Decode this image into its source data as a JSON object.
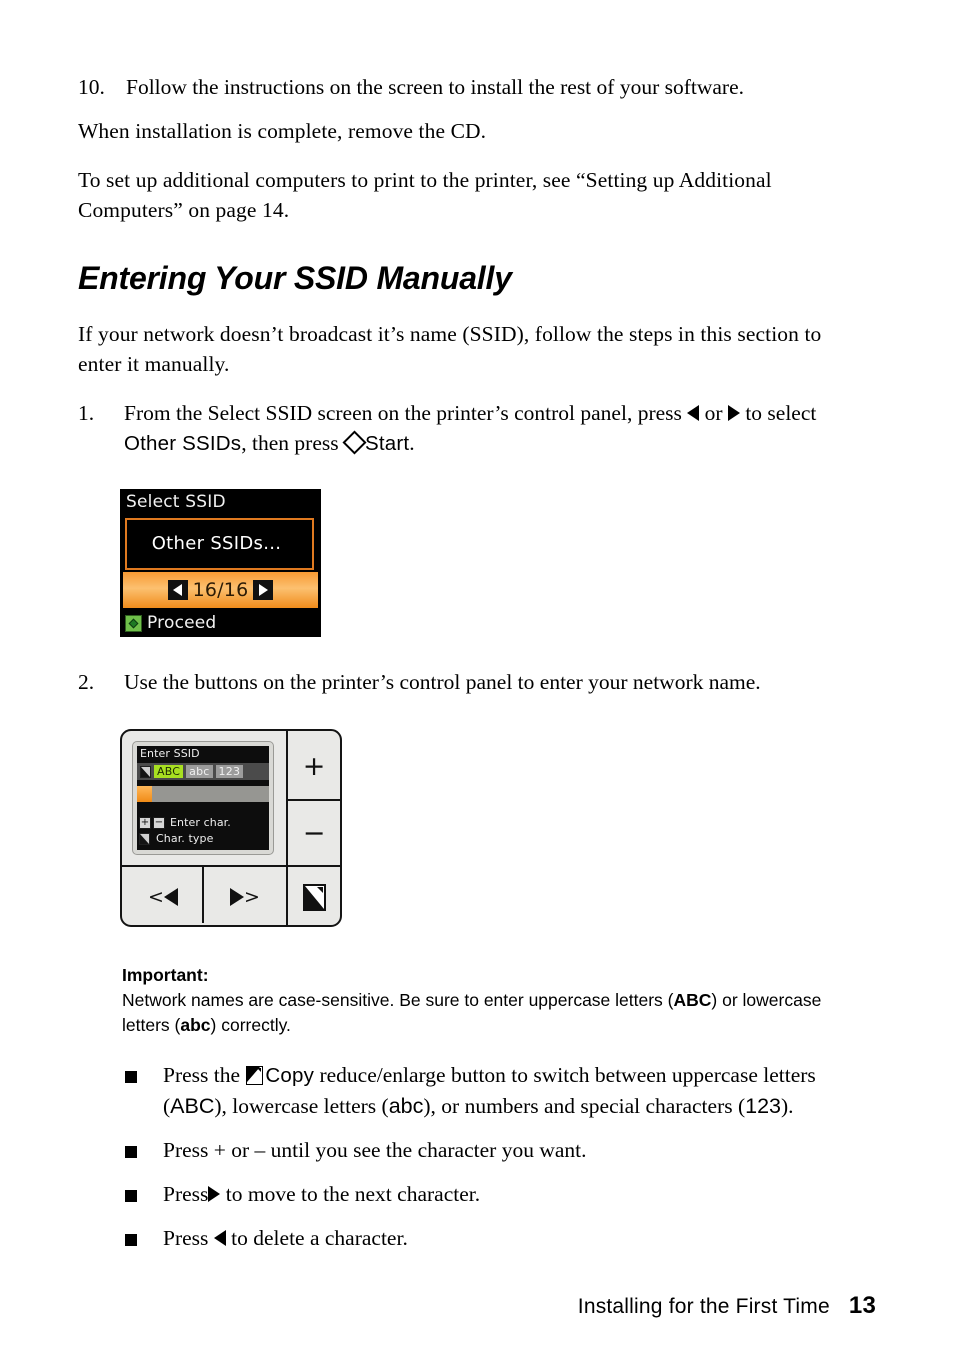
{
  "page": {
    "number": "13",
    "footer_section": "Installing for the First Time"
  },
  "body": {
    "step10": {
      "num": "10.",
      "text": "Follow the instructions on the screen to install the rest of your software."
    },
    "para_cd": "When installation is complete, remove the CD.",
    "para_additional": "To set up additional computers to print to the printer, see “Setting up Additional Computers” on page 14.",
    "heading": "Entering Your SSID Manually",
    "intro": "If your network doesn’t broadcast it’s name (SSID), follow the steps in this section to enter it manually.",
    "step1": {
      "num": "1.",
      "part1": "From the Select SSID screen on the printer’s control panel, press ",
      "or": " or ",
      "part2": " to select ",
      "ssid_token": "Other SSIDs",
      "part3": ", then press ",
      "start_token": "Start",
      "part4": "."
    },
    "step2": {
      "num": "2.",
      "text": "Use the buttons on the printer’s control panel to enter your network name."
    }
  },
  "lcd_select_ssid": {
    "title": "Select SSID",
    "selected_item": "Other SSIDs...",
    "counter": "16/16",
    "left_arrow_icon": "triangle-left-icon",
    "right_arrow_icon": "triangle-right-icon",
    "footer_icon": "start-diamond-icon",
    "footer_label": "Proceed",
    "colors": {
      "background": "#000000",
      "accent_orange": "#f08c1c",
      "border_orange": "#e07a20",
      "proceed_green": "#6fbf4a"
    }
  },
  "control_panel": {
    "lcd": {
      "title": "Enter SSID",
      "type_icon": "copy-reduce-enlarge-icon",
      "char_types": [
        {
          "label": "ABC",
          "state": "active"
        },
        {
          "label": "abc",
          "state": "idle"
        },
        {
          "label": "123",
          "state": "idle"
        }
      ],
      "input_value": "",
      "hint_plus": "+",
      "hint_minus": "−",
      "hint_enter_char": "Enter char.",
      "hint_char_type": "Char. type",
      "hint_char_type_icon": "copy-reduce-enlarge-icon",
      "colors": {
        "highlight_green": "#a8e021",
        "cursor_orange": "#f08b17",
        "input_bar_gray": "#969692",
        "type_row_gray": "#4b4b4b"
      }
    },
    "buttons": {
      "plus": "+",
      "minus": "−",
      "prev": "<◀",
      "next": "▶>",
      "copy_icon": "copy-reduce-enlarge-icon"
    }
  },
  "important": {
    "title": "Important:",
    "text_part1": "Network names are case-sensitive. Be sure to enter uppercase letters (",
    "token_abc_upper": "ABC",
    "text_part2": ") or lowercase letters (",
    "token_abc_lower": "abc",
    "text_part3": ") correctly."
  },
  "bullets": [
    {
      "id": "copy-button",
      "pre": "Press the ",
      "icon": "copy-reduce-enlarge-icon",
      "token_copy": "Copy",
      "mid1": " reduce/enlarge button to switch between uppercase letters (",
      "token_upper": "ABC",
      "mid2": "), lowercase letters (",
      "token_lower": "abc",
      "mid3": "), or numbers and special characters (",
      "token_num": "123",
      "post": ")."
    },
    {
      "id": "plus-minus",
      "text": "Press + or – until you see the character you want."
    },
    {
      "id": "next-char",
      "pre": "Press",
      "icon": "triangle-right-icon",
      "post": " to move to the next character."
    },
    {
      "id": "delete-char",
      "pre": "Press ",
      "icon": "triangle-left-icon",
      "post": " to delete a character."
    }
  ]
}
